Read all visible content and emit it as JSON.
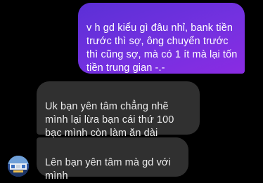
{
  "conversation": {
    "messages": [
      {
        "sender": "me",
        "text": "v h gd kiểu gì đâu nhỉ, bank tiền trước thì sợ, ông chuyển trước thì cũng sợ, mà có 1 ít mà lại tốn tiền trung gian -.-"
      },
      {
        "sender": "contact",
        "text": "Uk bạn yên tâm chẳng nhẽ mình lại lừa bạn cái thứ 100 bạc mình còn làm ăn dài"
      },
      {
        "sender": "contact",
        "text": "Lên bạn yên tâm mà gd với mình"
      }
    ]
  },
  "colors": {
    "background": "#000000",
    "sent_gradient_start": "#5b2fd6",
    "sent_gradient_end": "#8a2be2",
    "received_bubble": "#303030",
    "sent_text": "#ffffff",
    "received_text": "#ececec"
  },
  "icons": {
    "avatar": "contact-avatar-image"
  }
}
